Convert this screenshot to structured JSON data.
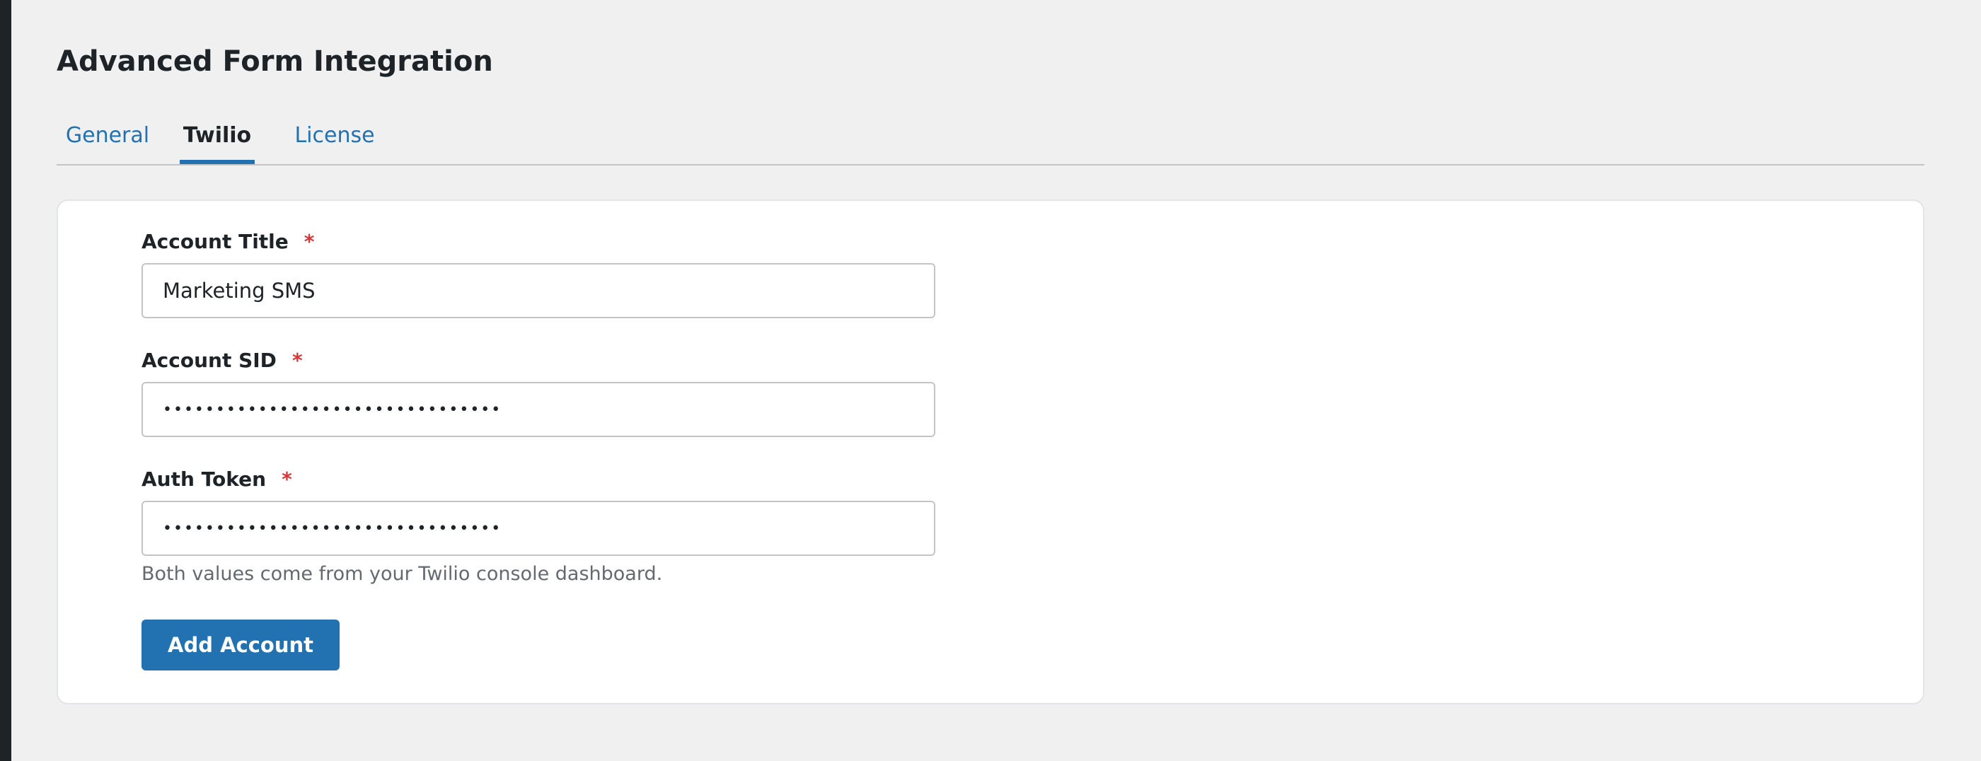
{
  "page": {
    "title": "Advanced Form Integration"
  },
  "tabs": [
    {
      "label": "General",
      "active": false
    },
    {
      "label": "Twilio",
      "active": true
    },
    {
      "label": "License",
      "active": false
    }
  ],
  "form": {
    "account_title": {
      "label": "Account Title",
      "required_mark": "*",
      "value": "Marketing SMS"
    },
    "account_sid": {
      "label": "Account SID",
      "required_mark": "*",
      "value": "••••••••••••••••••••••••••••••••"
    },
    "auth_token": {
      "label": "Auth Token",
      "required_mark": "*",
      "value": "••••••••••••••••••••••••••••••••"
    },
    "help_text": "Both values come from your Twilio console dashboard.",
    "submit_label": "Add Account"
  },
  "colors": {
    "accent": "#2271b1",
    "required": "#d63638",
    "background": "#f0f0f1",
    "admin_bar": "#1d2327"
  }
}
